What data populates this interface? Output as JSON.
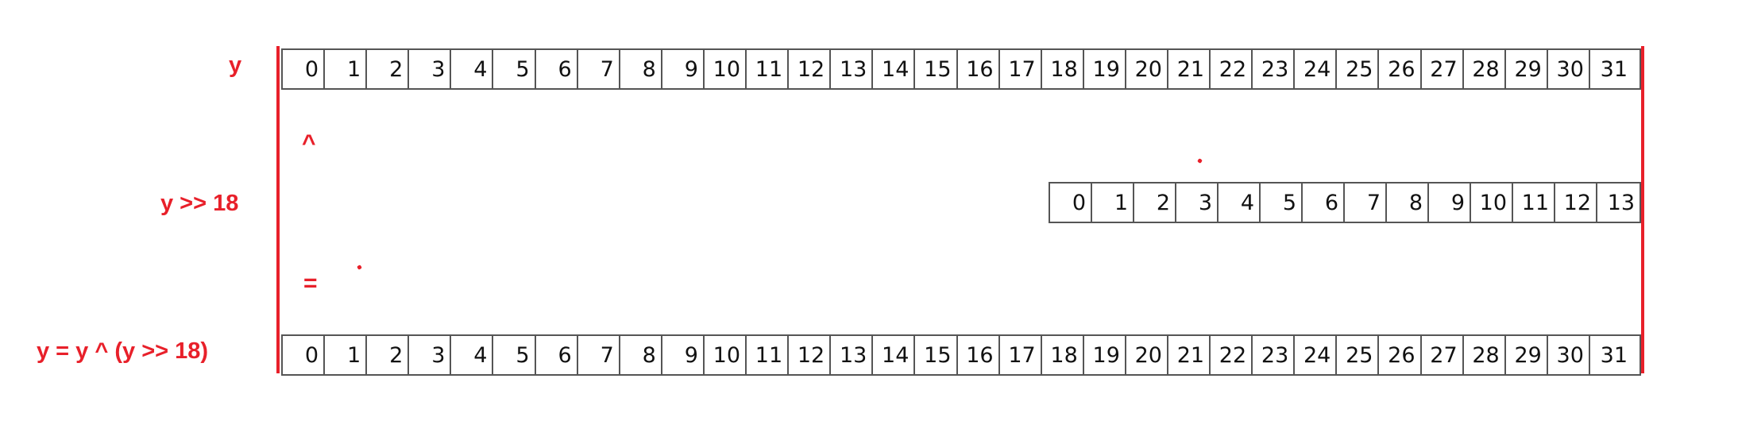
{
  "rows": [
    {
      "label": "y",
      "bits": [
        "0",
        "1",
        "2",
        "3",
        "4",
        "5",
        "6",
        "7",
        "8",
        "9",
        "10",
        "11",
        "12",
        "13",
        "14",
        "15",
        "16",
        "17",
        "18",
        "19",
        "20",
        "21",
        "22",
        "23",
        "24",
        "25",
        "26",
        "27",
        "28",
        "29",
        "30",
        "31"
      ]
    },
    {
      "label": "y >> 18",
      "bits": [
        "0",
        "1",
        "2",
        "3",
        "4",
        "5",
        "6",
        "7",
        "8",
        "9",
        "10",
        "11",
        "12",
        "13"
      ]
    },
    {
      "label": "y = y ^ (y >> 18)",
      "bits": [
        "0",
        "1",
        "2",
        "3",
        "4",
        "5",
        "6",
        "7",
        "8",
        "9",
        "10",
        "11",
        "12",
        "13",
        "14",
        "15",
        "16",
        "17",
        "18",
        "19",
        "20",
        "21",
        "22",
        "23",
        "24",
        "25",
        "26",
        "27",
        "28",
        "29",
        "30",
        "31"
      ]
    }
  ],
  "operators": {
    "xor": "^",
    "equals": "="
  },
  "colors": {
    "accent": "#e8202a",
    "cell_border": "#555555",
    "text": "#111111"
  }
}
